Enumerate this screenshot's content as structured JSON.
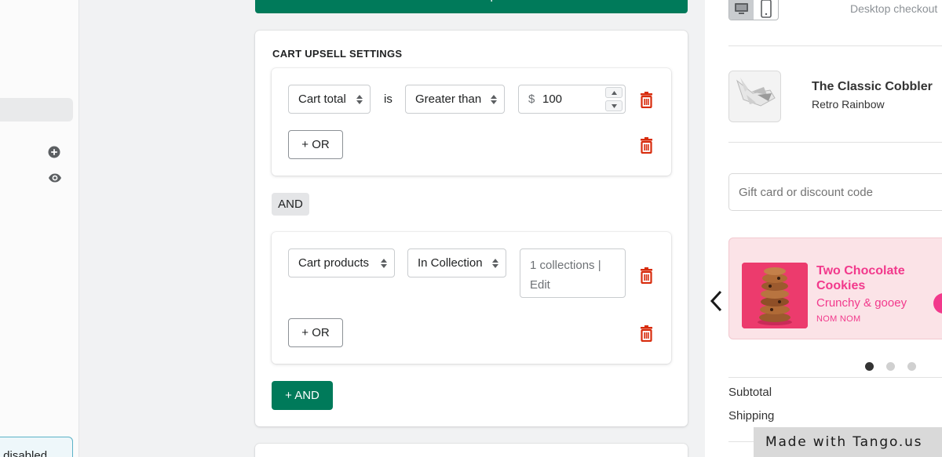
{
  "top_button": {
    "label": "+ Add another product"
  },
  "settings": {
    "title": "CART UPSELL SETTINGS",
    "group1": {
      "condition_select": "Cart total",
      "connector": "is",
      "operator_select": "Greater than",
      "currency_symbol": "$",
      "amount": "100",
      "or_button": "+ OR"
    },
    "and_chip": "AND",
    "group2": {
      "condition_select": "Cart products",
      "operator_select": "In Collection",
      "collections_text": "1 collections |",
      "edit_text": "Edit",
      "or_button": "+ OR"
    },
    "and_button": "+ AND"
  },
  "left_panel": {
    "bottom_text": "r disabled"
  },
  "preview": {
    "device_label": "Desktop checkout",
    "product": {
      "title": "The Classic Cobbler",
      "variant": "Retro Rainbow"
    },
    "gift_placeholder": "Gift card or discount code",
    "upsell": {
      "title": "Two Chocolate Cookies",
      "subtitle": "Crunchy & gooey",
      "tag": "NOM NOM",
      "accent": "#f2398c"
    },
    "carousel": {
      "pages": 3,
      "active_index": 0
    },
    "summary": {
      "subtotal_label": "Subtotal",
      "shipping_label": "Shipping"
    }
  },
  "watermark": "Made with Tango.us",
  "colors": {
    "primary_green": "#007a5a",
    "delete_red": "#d82c0d"
  }
}
